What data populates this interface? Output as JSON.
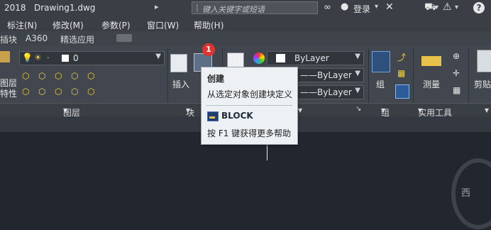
{
  "titlebar": {
    "year": "2018",
    "doc_name": "Drawing1.dwg",
    "search_placeholder": "键入关键字或短语",
    "login": "登录"
  },
  "menubar": {
    "items": [
      "标注(N)",
      "修改(M)",
      "参数(P)",
      "窗口(W)",
      "帮助(H)"
    ]
  },
  "ribbon_tabs": {
    "items": [
      "插块",
      "A360",
      "精选应用"
    ]
  },
  "ribbon": {
    "layer_combo_value": "0",
    "bylayer_1": "ByLayer",
    "bylayer_2": "ByLayer",
    "bylayer_3": "ByLayer",
    "insert_label": "插入",
    "group_label": "组",
    "measure_label": "测量",
    "paste_label": "剪贴",
    "layer_props_label_1": "图层",
    "layer_props_label_2": "特性",
    "panel_layers": "图层",
    "panel_block": "块",
    "panel_groups": "组",
    "panel_utilities": "实用工具"
  },
  "badge": {
    "count": "1"
  },
  "tooltip": {
    "title": "创建",
    "description": "从选定对象创建块定义",
    "command": "BLOCK",
    "help": "按 F1 键获得更多帮助"
  },
  "viewcube": {
    "label": "西"
  }
}
